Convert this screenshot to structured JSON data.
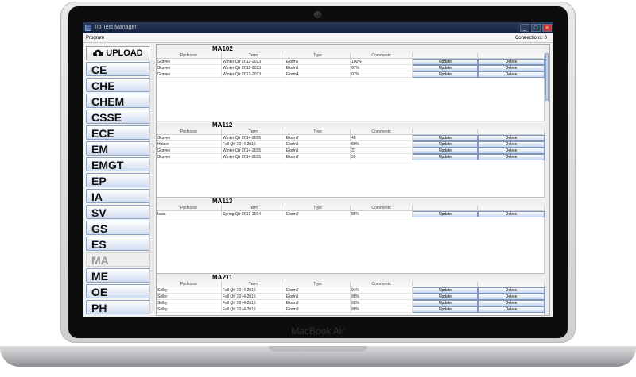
{
  "device": {
    "label": "MacBook Air"
  },
  "window": {
    "title": "Tip Test Manager",
    "controls": [
      "_",
      "□",
      "×"
    ]
  },
  "menu": {
    "program": "Program",
    "connections": "Connections: 0"
  },
  "sidebar": {
    "upload_label": "UPLOAD",
    "upload_icon": "cloud-upload-icon",
    "active": "MA",
    "departments": [
      "CE",
      "CHE",
      "CHEM",
      "CSSE",
      "ECE",
      "EM",
      "EMGT",
      "EP",
      "IA",
      "SV",
      "GS",
      "ES",
      "MA",
      "ME",
      "OE",
      "PH"
    ]
  },
  "table": {
    "headers": [
      "Professor",
      "Term",
      "Type",
      "Comments",
      "",
      ""
    ],
    "update_label": "Update",
    "delete_label": "Delete"
  },
  "courses": [
    {
      "name": "MA102",
      "rows": [
        [
          "Graves",
          "Winter Qtr 2012-2013",
          "Exam2",
          "100%"
        ],
        [
          "Graves",
          "Winter Qtr 2012-2013",
          "Exam1",
          "97%"
        ],
        [
          "Graves",
          "Winter Qtr 2012-2013",
          "Exam4",
          "97%"
        ]
      ]
    },
    {
      "name": "MA112",
      "rows": [
        [
          "Graves",
          "Winter Qtr 2014-2015",
          "Exam2",
          "40"
        ],
        [
          "Holder",
          "Fall Qtr 2014-2015",
          "Exam1",
          "80%"
        ],
        [
          "Graves",
          "Winter Qtr 2014-2015",
          "Exam1",
          "37"
        ],
        [
          "Graves",
          "Winter Qtr 2014-2015",
          "Exam2",
          "95"
        ]
      ]
    },
    {
      "name": "MA113",
      "rows": [
        [
          "Isaia",
          "Spring Qtr 2013-2014",
          "Exam3",
          "86%"
        ]
      ]
    },
    {
      "name": "MA211",
      "rows": [
        [
          "Selby",
          "Fall Qtr 2014-2015",
          "Exam2",
          "91%"
        ],
        [
          "Selby",
          "Fall Qtr 2014-2015",
          "Exam1",
          "88%"
        ],
        [
          "Selby",
          "Fall Qtr 2014-2015",
          "Exam3",
          "88%"
        ],
        [
          "Selby",
          "Fall Qtr 2014-2015",
          "Exam3",
          "88%"
        ]
      ]
    }
  ]
}
